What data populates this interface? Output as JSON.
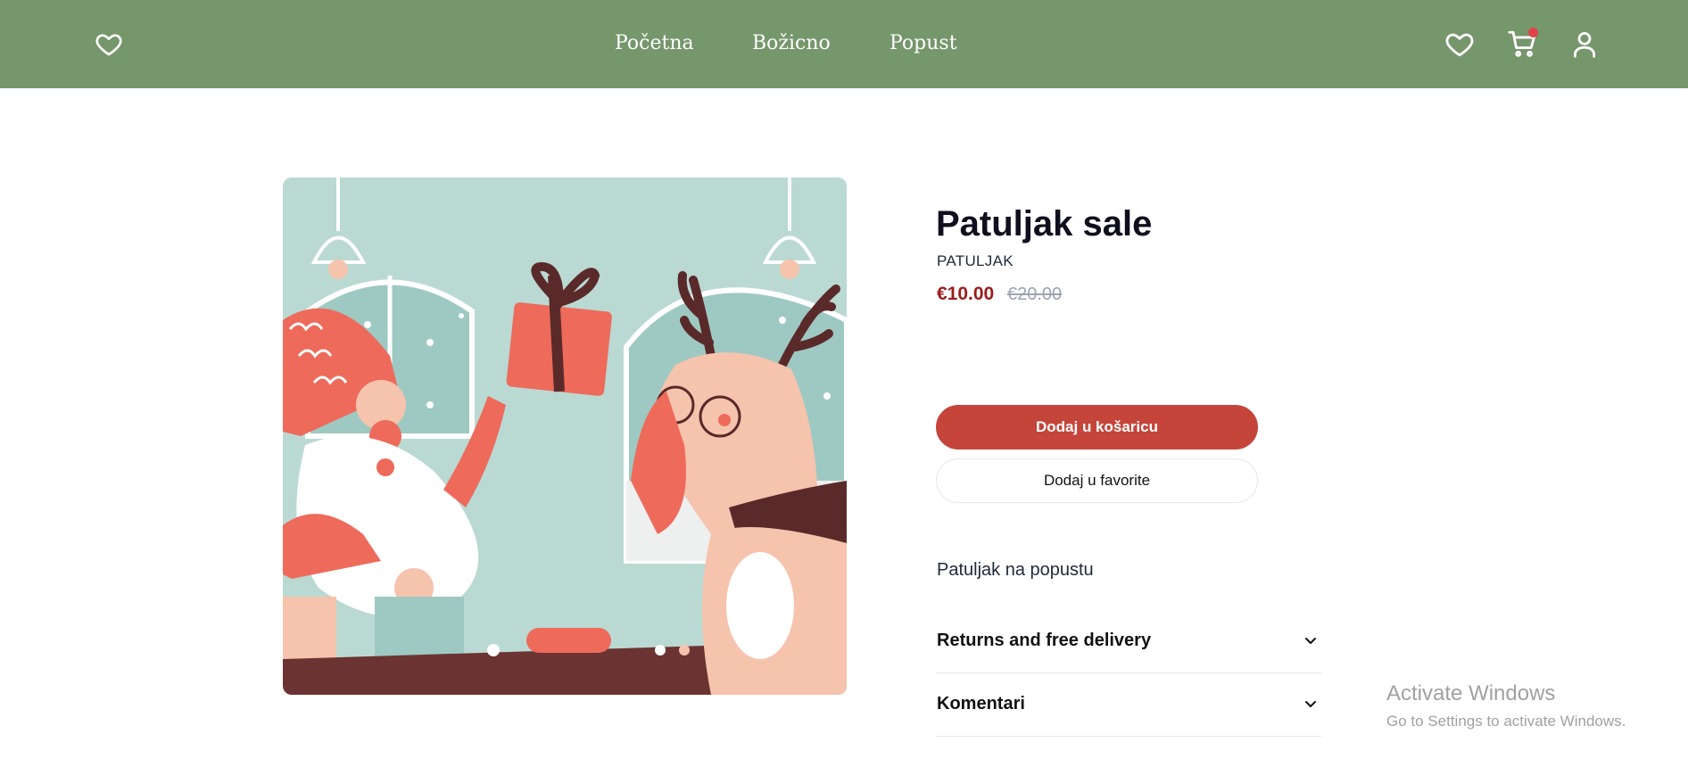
{
  "header": {
    "logo_icon": "heart-outline-icon",
    "nav": [
      {
        "label": "Početna"
      },
      {
        "label": "Božicno"
      },
      {
        "label": "Popust"
      }
    ],
    "icons": [
      "heart-icon",
      "cart-icon",
      "user-icon"
    ],
    "cart_has_notification": true
  },
  "product": {
    "title": "Patuljak sale",
    "brand": "PATULJAK",
    "price": "€10.00",
    "old_price": "€20.00",
    "add_to_cart_label": "Dodaj u košaricu",
    "add_to_favorites_label": "Dodaj u favorite",
    "description": "Patuljak na popustu",
    "accordions": [
      {
        "label": "Returns and free delivery"
      },
      {
        "label": "Komentari"
      }
    ]
  },
  "watermark": {
    "title": "Activate Windows",
    "subtitle": "Go to Settings to activate Windows."
  },
  "colors": {
    "header_bg": "#76966b",
    "primary_button": "#c5453a",
    "price": "#9b1c1c"
  }
}
